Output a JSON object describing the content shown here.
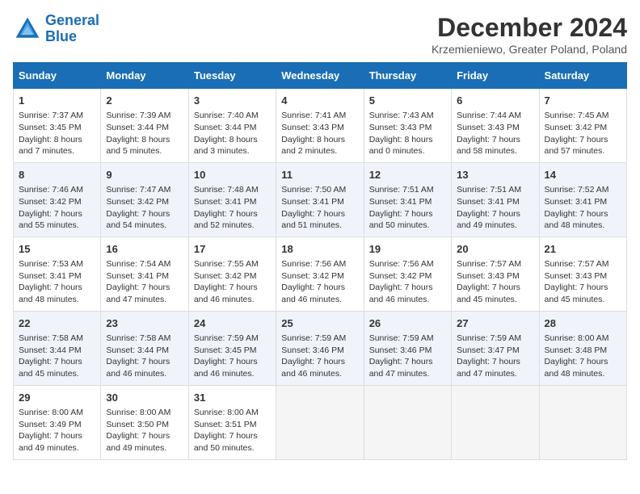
{
  "logo": {
    "line1": "General",
    "line2": "Blue"
  },
  "title": "December 2024",
  "subtitle": "Krzemieniewo, Greater Poland, Poland",
  "days_of_week": [
    "Sunday",
    "Monday",
    "Tuesday",
    "Wednesday",
    "Thursday",
    "Friday",
    "Saturday"
  ],
  "weeks": [
    [
      {
        "day": "1",
        "sunrise": "Sunrise: 7:37 AM",
        "sunset": "Sunset: 3:45 PM",
        "daylight": "Daylight: 8 hours and 7 minutes."
      },
      {
        "day": "2",
        "sunrise": "Sunrise: 7:39 AM",
        "sunset": "Sunset: 3:44 PM",
        "daylight": "Daylight: 8 hours and 5 minutes."
      },
      {
        "day": "3",
        "sunrise": "Sunrise: 7:40 AM",
        "sunset": "Sunset: 3:44 PM",
        "daylight": "Daylight: 8 hours and 3 minutes."
      },
      {
        "day": "4",
        "sunrise": "Sunrise: 7:41 AM",
        "sunset": "Sunset: 3:43 PM",
        "daylight": "Daylight: 8 hours and 2 minutes."
      },
      {
        "day": "5",
        "sunrise": "Sunrise: 7:43 AM",
        "sunset": "Sunset: 3:43 PM",
        "daylight": "Daylight: 8 hours and 0 minutes."
      },
      {
        "day": "6",
        "sunrise": "Sunrise: 7:44 AM",
        "sunset": "Sunset: 3:43 PM",
        "daylight": "Daylight: 7 hours and 58 minutes."
      },
      {
        "day": "7",
        "sunrise": "Sunrise: 7:45 AM",
        "sunset": "Sunset: 3:42 PM",
        "daylight": "Daylight: 7 hours and 57 minutes."
      }
    ],
    [
      {
        "day": "8",
        "sunrise": "Sunrise: 7:46 AM",
        "sunset": "Sunset: 3:42 PM",
        "daylight": "Daylight: 7 hours and 55 minutes."
      },
      {
        "day": "9",
        "sunrise": "Sunrise: 7:47 AM",
        "sunset": "Sunset: 3:42 PM",
        "daylight": "Daylight: 7 hours and 54 minutes."
      },
      {
        "day": "10",
        "sunrise": "Sunrise: 7:48 AM",
        "sunset": "Sunset: 3:41 PM",
        "daylight": "Daylight: 7 hours and 52 minutes."
      },
      {
        "day": "11",
        "sunrise": "Sunrise: 7:50 AM",
        "sunset": "Sunset: 3:41 PM",
        "daylight": "Daylight: 7 hours and 51 minutes."
      },
      {
        "day": "12",
        "sunrise": "Sunrise: 7:51 AM",
        "sunset": "Sunset: 3:41 PM",
        "daylight": "Daylight: 7 hours and 50 minutes."
      },
      {
        "day": "13",
        "sunrise": "Sunrise: 7:51 AM",
        "sunset": "Sunset: 3:41 PM",
        "daylight": "Daylight: 7 hours and 49 minutes."
      },
      {
        "day": "14",
        "sunrise": "Sunrise: 7:52 AM",
        "sunset": "Sunset: 3:41 PM",
        "daylight": "Daylight: 7 hours and 48 minutes."
      }
    ],
    [
      {
        "day": "15",
        "sunrise": "Sunrise: 7:53 AM",
        "sunset": "Sunset: 3:41 PM",
        "daylight": "Daylight: 7 hours and 48 minutes."
      },
      {
        "day": "16",
        "sunrise": "Sunrise: 7:54 AM",
        "sunset": "Sunset: 3:41 PM",
        "daylight": "Daylight: 7 hours and 47 minutes."
      },
      {
        "day": "17",
        "sunrise": "Sunrise: 7:55 AM",
        "sunset": "Sunset: 3:42 PM",
        "daylight": "Daylight: 7 hours and 46 minutes."
      },
      {
        "day": "18",
        "sunrise": "Sunrise: 7:56 AM",
        "sunset": "Sunset: 3:42 PM",
        "daylight": "Daylight: 7 hours and 46 minutes."
      },
      {
        "day": "19",
        "sunrise": "Sunrise: 7:56 AM",
        "sunset": "Sunset: 3:42 PM",
        "daylight": "Daylight: 7 hours and 46 minutes."
      },
      {
        "day": "20",
        "sunrise": "Sunrise: 7:57 AM",
        "sunset": "Sunset: 3:43 PM",
        "daylight": "Daylight: 7 hours and 45 minutes."
      },
      {
        "day": "21",
        "sunrise": "Sunrise: 7:57 AM",
        "sunset": "Sunset: 3:43 PM",
        "daylight": "Daylight: 7 hours and 45 minutes."
      }
    ],
    [
      {
        "day": "22",
        "sunrise": "Sunrise: 7:58 AM",
        "sunset": "Sunset: 3:44 PM",
        "daylight": "Daylight: 7 hours and 45 minutes."
      },
      {
        "day": "23",
        "sunrise": "Sunrise: 7:58 AM",
        "sunset": "Sunset: 3:44 PM",
        "daylight": "Daylight: 7 hours and 46 minutes."
      },
      {
        "day": "24",
        "sunrise": "Sunrise: 7:59 AM",
        "sunset": "Sunset: 3:45 PM",
        "daylight": "Daylight: 7 hours and 46 minutes."
      },
      {
        "day": "25",
        "sunrise": "Sunrise: 7:59 AM",
        "sunset": "Sunset: 3:46 PM",
        "daylight": "Daylight: 7 hours and 46 minutes."
      },
      {
        "day": "26",
        "sunrise": "Sunrise: 7:59 AM",
        "sunset": "Sunset: 3:46 PM",
        "daylight": "Daylight: 7 hours and 47 minutes."
      },
      {
        "day": "27",
        "sunrise": "Sunrise: 7:59 AM",
        "sunset": "Sunset: 3:47 PM",
        "daylight": "Daylight: 7 hours and 47 minutes."
      },
      {
        "day": "28",
        "sunrise": "Sunrise: 8:00 AM",
        "sunset": "Sunset: 3:48 PM",
        "daylight": "Daylight: 7 hours and 48 minutes."
      }
    ],
    [
      {
        "day": "29",
        "sunrise": "Sunrise: 8:00 AM",
        "sunset": "Sunset: 3:49 PM",
        "daylight": "Daylight: 7 hours and 49 minutes."
      },
      {
        "day": "30",
        "sunrise": "Sunrise: 8:00 AM",
        "sunset": "Sunset: 3:50 PM",
        "daylight": "Daylight: 7 hours and 49 minutes."
      },
      {
        "day": "31",
        "sunrise": "Sunrise: 8:00 AM",
        "sunset": "Sunset: 3:51 PM",
        "daylight": "Daylight: 7 hours and 50 minutes."
      },
      null,
      null,
      null,
      null
    ]
  ]
}
